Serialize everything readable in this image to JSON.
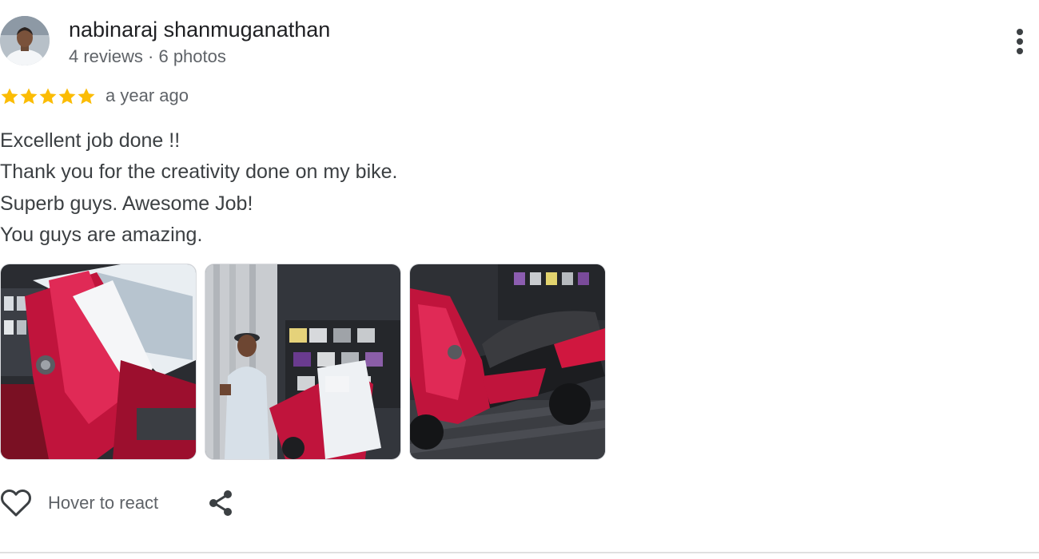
{
  "review": {
    "author": {
      "name": "nabinaraj shanmuganathan",
      "meta": "4 reviews · 6 photos",
      "avatar_icon": "profile-photo"
    },
    "rating": 5,
    "rating_max": 5,
    "time_ago": "a year ago",
    "text_lines": [
      "Excellent job done !!",
      "Thank you for the creativity done on my bike.",
      "Superb guys. Awesome Job!",
      "You guys are amazing."
    ],
    "photos": [
      {
        "subject": "red scooter front fairing closeup"
      },
      {
        "subject": "man giving thumbs up beside scooter in shop"
      },
      {
        "subject": "red scooter side view on tiled floor"
      }
    ],
    "actions": {
      "react_label": "Hover to react",
      "react_icon": "heart-outline-icon",
      "share_icon": "share-icon",
      "more_icon": "more-vert-icon"
    }
  },
  "colors": {
    "star": "#fbbc04",
    "primary_text": "#202124",
    "secondary_text": "#5f6368",
    "accent_red": "#c0143c"
  }
}
